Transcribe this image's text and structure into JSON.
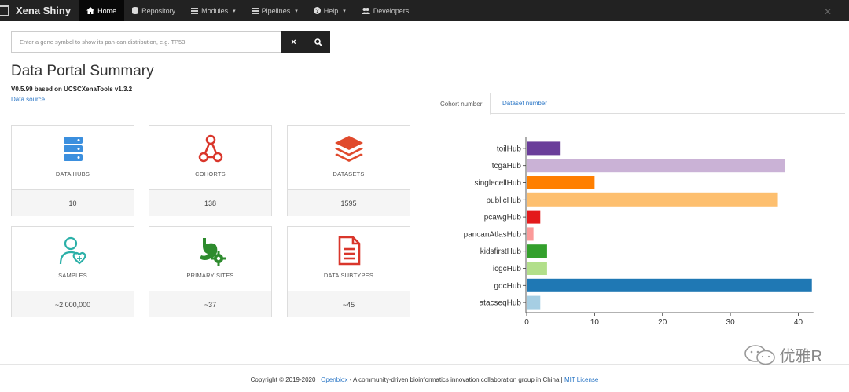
{
  "navbar": {
    "brand": "Xena Shiny",
    "items": [
      {
        "label": "Home",
        "icon": "home-icon",
        "active": true,
        "caret": false
      },
      {
        "label": "Repository",
        "icon": "database-icon",
        "active": false,
        "caret": false
      },
      {
        "label": "Modules",
        "icon": "list-icon",
        "active": false,
        "caret": true
      },
      {
        "label": "Pipelines",
        "icon": "list-icon",
        "active": false,
        "caret": true
      },
      {
        "label": "Help",
        "icon": "question-circle-icon",
        "active": false,
        "caret": true
      },
      {
        "label": "Developers",
        "icon": "users-icon",
        "active": false,
        "caret": false
      }
    ]
  },
  "search": {
    "placeholder": "Enter a gene symbol to show its pan-can distribution, e.g. TP53",
    "value": "",
    "clear_label": "×"
  },
  "summary": {
    "title": "Data Portal Summary",
    "version": "V0.5.99 based on UCSCXenaTools v1.3.2",
    "data_source_link": "Data source"
  },
  "cards": [
    {
      "label": "DATA HUBS",
      "value": "10",
      "icon": "server-stack-icon",
      "color": "#3b8fde"
    },
    {
      "label": "COHORTS",
      "value": "138",
      "icon": "network-nodes-icon",
      "color": "#d9362b"
    },
    {
      "label": "DATASETS",
      "value": "1595",
      "icon": "layers-icon",
      "color": "#e04a2d"
    },
    {
      "label": "SAMPLES",
      "value": "~2,000,000",
      "icon": "user-medical-icon",
      "color": "#2bb0a8"
    },
    {
      "label": "PRIMARY SITES",
      "value": "~37",
      "icon": "stomach-gear-icon",
      "color": "#2e8b2e"
    },
    {
      "label": "DATA SUBTYPES",
      "value": "~45",
      "icon": "file-text-icon",
      "color": "#d9362b"
    }
  ],
  "tabs": [
    {
      "label": "Cohort number",
      "active": true
    },
    {
      "label": "Dataset number",
      "active": false
    }
  ],
  "chart_data": {
    "type": "bar",
    "orientation": "horizontal",
    "categories": [
      "toilHub",
      "tcgaHub",
      "singlecellHub",
      "publicHub",
      "pcawgHub",
      "pancanAtlasHub",
      "kidsfirstHub",
      "icgcHub",
      "gdcHub",
      "atacseqHub"
    ],
    "values": [
      5,
      38,
      10,
      37,
      2,
      1,
      3,
      3,
      42,
      2
    ],
    "colors": [
      "#6a3d9a",
      "#cab2d6",
      "#ff7f00",
      "#fdbf6f",
      "#e31a1c",
      "#fb9a99",
      "#33a02c",
      "#b2df8a",
      "#1f78b4",
      "#a6cee3"
    ],
    "xticks": [
      "0",
      "10",
      "20",
      "30",
      "40"
    ],
    "xlim": [
      0,
      44
    ],
    "grid": false
  },
  "footer": {
    "copyright": "Copyright © 2019-2020",
    "org_link": "Openbiox",
    "description": " - A community-driven bioinformatics innovation collaboration group in China | ",
    "license_link": "MIT License"
  },
  "watermark": {
    "text": "优雅R"
  }
}
